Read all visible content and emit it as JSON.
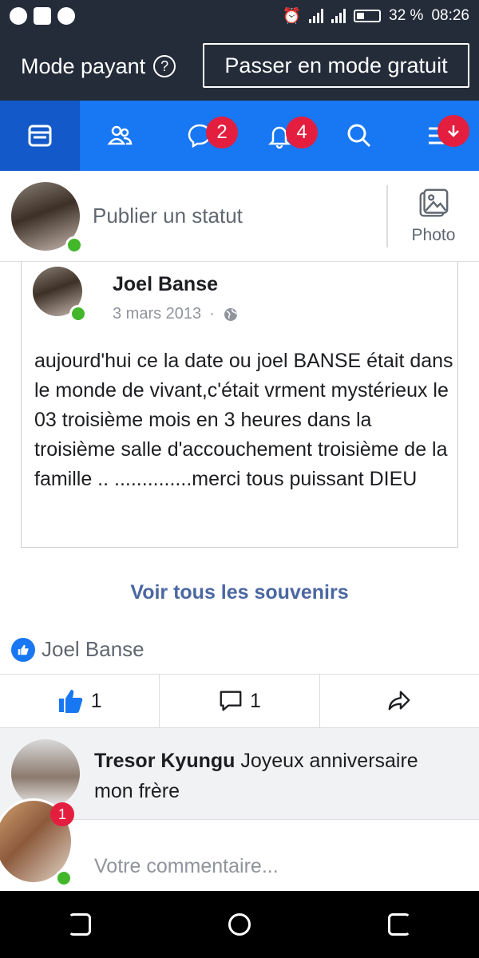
{
  "status_bar": {
    "battery": "32 %",
    "time": "08:26"
  },
  "mode_bar": {
    "label": "Mode payant",
    "button": "Passer en mode gratuit"
  },
  "nav": {
    "messages_badge": "2",
    "notifications_badge": "4"
  },
  "composer": {
    "placeholder": "Publier un statut",
    "photo_label": "Photo"
  },
  "memory": {
    "author": "Joel Banse",
    "date": "3 mars 2013",
    "separator": "·",
    "text": "aujourd'hui ce la date ou joel BANSE était dans le monde de vivant,c'était vrment mystérieux  le 03 troisième mois en 3 heures dans la troisième salle d'accouchement troisième de la famille .. ..............merci tous puissant DIEU"
  },
  "see_all": "Voir tous les souvenirs",
  "likes": {
    "name": "Joel Banse"
  },
  "actions": {
    "like_count": "1",
    "comment_count": "1"
  },
  "comment": {
    "author": "Tresor Kyungu",
    "text": "Joyeux anniversaire mon frère"
  },
  "reply": {
    "placeholder": "Votre commentaire..."
  },
  "chat_head": {
    "badge": "1"
  },
  "colors": {
    "brand": "#1877f2",
    "header": "#242c3a",
    "badge": "#e41e3f",
    "online": "#42b72a",
    "link": "#4b67a1"
  }
}
